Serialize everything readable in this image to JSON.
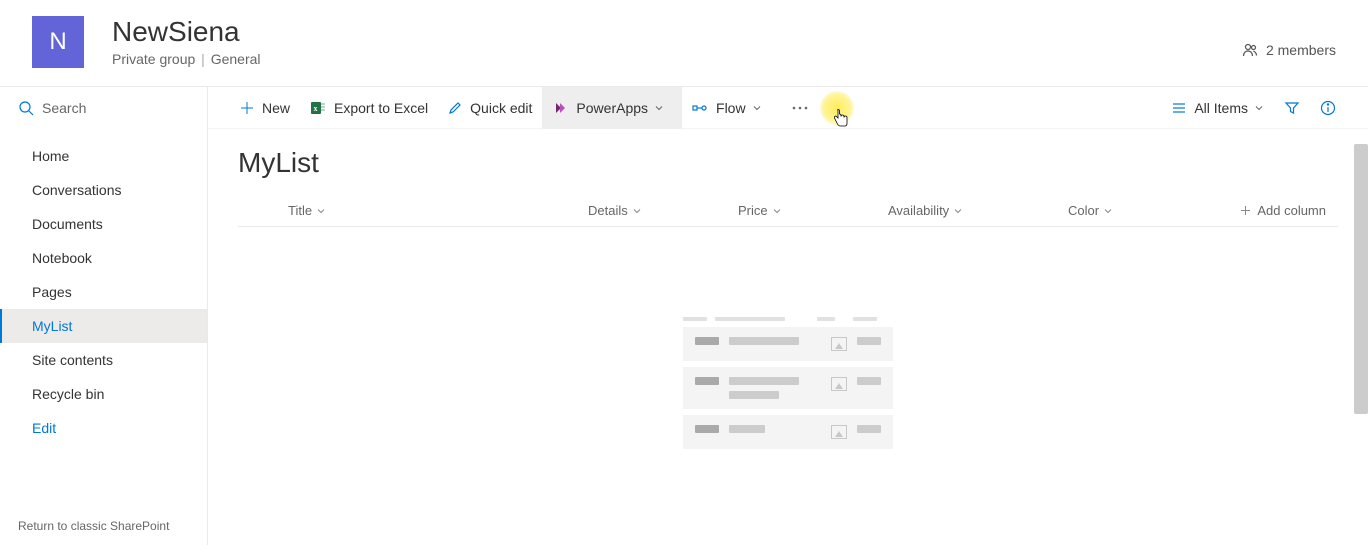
{
  "header": {
    "logo_letter": "N",
    "title": "NewSiena",
    "group_type": "Private group",
    "category": "General",
    "members_label": "2 members"
  },
  "sidebar": {
    "search_placeholder": "Search",
    "items": [
      {
        "label": "Home"
      },
      {
        "label": "Conversations"
      },
      {
        "label": "Documents"
      },
      {
        "label": "Notebook"
      },
      {
        "label": "Pages"
      },
      {
        "label": "MyList"
      },
      {
        "label": "Site contents"
      },
      {
        "label": "Recycle bin"
      },
      {
        "label": "Edit"
      }
    ],
    "classic_link": "Return to classic SharePoint"
  },
  "toolbar": {
    "new_label": "New",
    "export_label": "Export to Excel",
    "quick_edit_label": "Quick edit",
    "powerapps_label": "PowerApps",
    "flow_label": "Flow",
    "view_label": "All Items"
  },
  "list": {
    "title": "MyList",
    "columns": [
      {
        "label": "Title"
      },
      {
        "label": "Details"
      },
      {
        "label": "Price"
      },
      {
        "label": "Availability"
      },
      {
        "label": "Color"
      }
    ],
    "add_column_label": "Add column"
  }
}
